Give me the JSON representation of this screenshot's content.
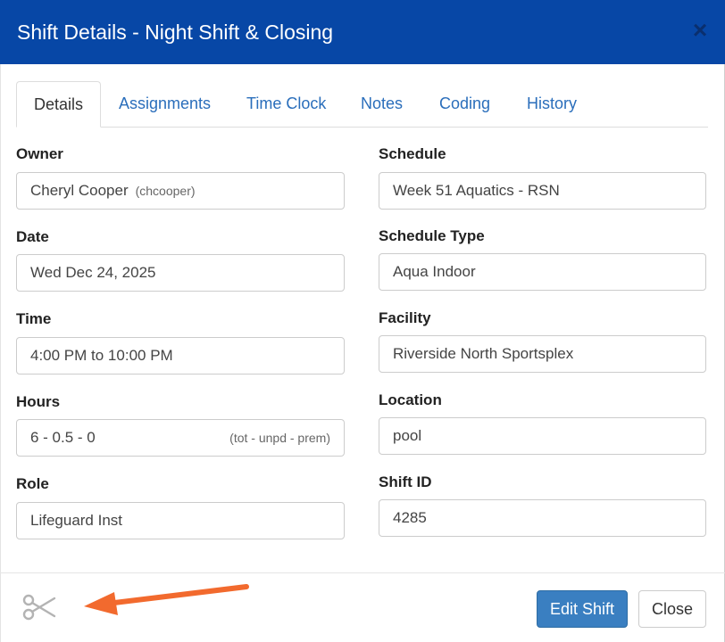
{
  "dialog": {
    "title": "Shift Details - Night Shift & Closing",
    "close_glyph": "×"
  },
  "tabs": [
    {
      "label": "Details",
      "active": true
    },
    {
      "label": "Assignments",
      "active": false
    },
    {
      "label": "Time Clock",
      "active": false
    },
    {
      "label": "Notes",
      "active": false
    },
    {
      "label": "Coding",
      "active": false
    },
    {
      "label": "History",
      "active": false
    }
  ],
  "fields": {
    "owner": {
      "label": "Owner",
      "value": "Cheryl Cooper",
      "sub": "(chcooper)"
    },
    "date": {
      "label": "Date",
      "value": "Wed Dec 24, 2025"
    },
    "time": {
      "label": "Time",
      "value": "4:00 PM to 10:00 PM"
    },
    "hours": {
      "label": "Hours",
      "value": "6 - 0.5 - 0",
      "hint": "(tot - unpd - prem)"
    },
    "role": {
      "label": "Role",
      "value": "Lifeguard Inst"
    },
    "schedule": {
      "label": "Schedule",
      "value": "Week 51 Aquatics - RSN"
    },
    "schedule_type": {
      "label": "Schedule Type",
      "value": "Aqua Indoor"
    },
    "facility": {
      "label": "Facility",
      "value": "Riverside North Sportsplex"
    },
    "location": {
      "label": "Location",
      "value": "pool"
    },
    "shift_id": {
      "label": "Shift ID",
      "value": "4285"
    }
  },
  "footer": {
    "edit_label": "Edit Shift",
    "close_label": "Close",
    "icons": {
      "scissors": "scissors-icon",
      "arrow": "arrow-annotation"
    }
  },
  "colors": {
    "header_bg": "#0747a6",
    "primary_button": "#3a7fc1",
    "tab_link": "#2a6ebb",
    "annotation_arrow": "#f26a2e"
  }
}
